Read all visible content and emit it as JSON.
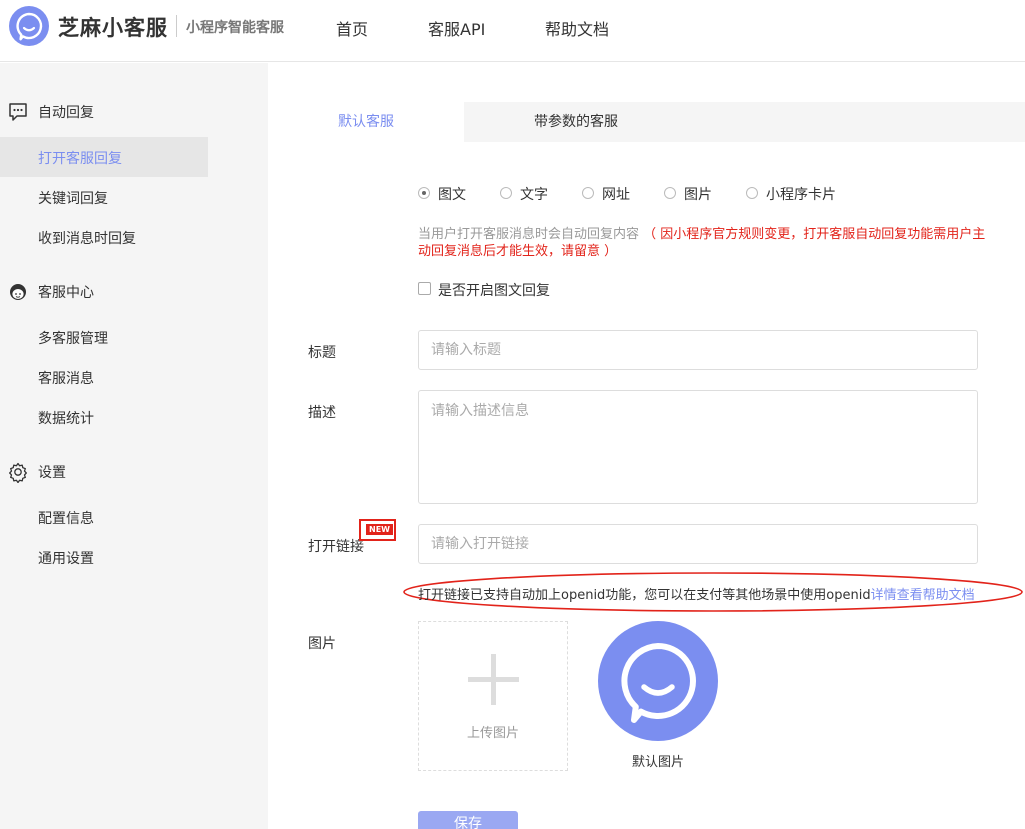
{
  "header": {
    "brand": "芝麻小客服",
    "subtitle": "小程序智能客服",
    "nav": [
      "首页",
      "客服API",
      "帮助文档"
    ]
  },
  "sidebar": {
    "groups": [
      {
        "label": "自动回复",
        "icon": "chat-bubble-icon",
        "items": [
          "打开客服回复",
          "关键词回复",
          "收到消息时回复"
        ]
      },
      {
        "label": "客服中心",
        "icon": "agent-avatar-icon",
        "items": [
          "多客服管理",
          "客服消息",
          "数据统计"
        ]
      },
      {
        "label": "设置",
        "icon": "gear-icon",
        "items": [
          "配置信息",
          "通用设置"
        ]
      }
    ],
    "active_item": "打开客服回复"
  },
  "tabs": [
    "默认客服",
    "带参数的客服"
  ],
  "active_tab": "默认客服",
  "reply_types": [
    "图文",
    "文字",
    "网址",
    "图片",
    "小程序卡片"
  ],
  "selected_reply_type": "图文",
  "hint": {
    "text": "当用户打开客服消息时会自动回复内容",
    "warning": "（ 因小程序官方规则变更，打开客服自动回复功能需用户主动回复消息后才能生效，请留意 ）"
  },
  "enable_checkbox_label": "是否开启图文回复",
  "form": {
    "title_label": "标题",
    "title_placeholder": "请输入标题",
    "desc_label": "描述",
    "desc_placeholder": "请输入描述信息",
    "link_label": "打开链接",
    "link_placeholder": "请输入打开链接",
    "new_badge": "NEW",
    "image_label": "图片"
  },
  "note": {
    "text": "打开链接已支持自动加上openid功能，您可以在支付等其他场景中使用openid",
    "link_text": "详情查看帮助文档"
  },
  "upload": {
    "label": "上传图片"
  },
  "default_image": {
    "label": "默认图片"
  },
  "save_button": "保存",
  "colors": {
    "accent": "#7b8ef0",
    "warning": "#e2231a"
  }
}
